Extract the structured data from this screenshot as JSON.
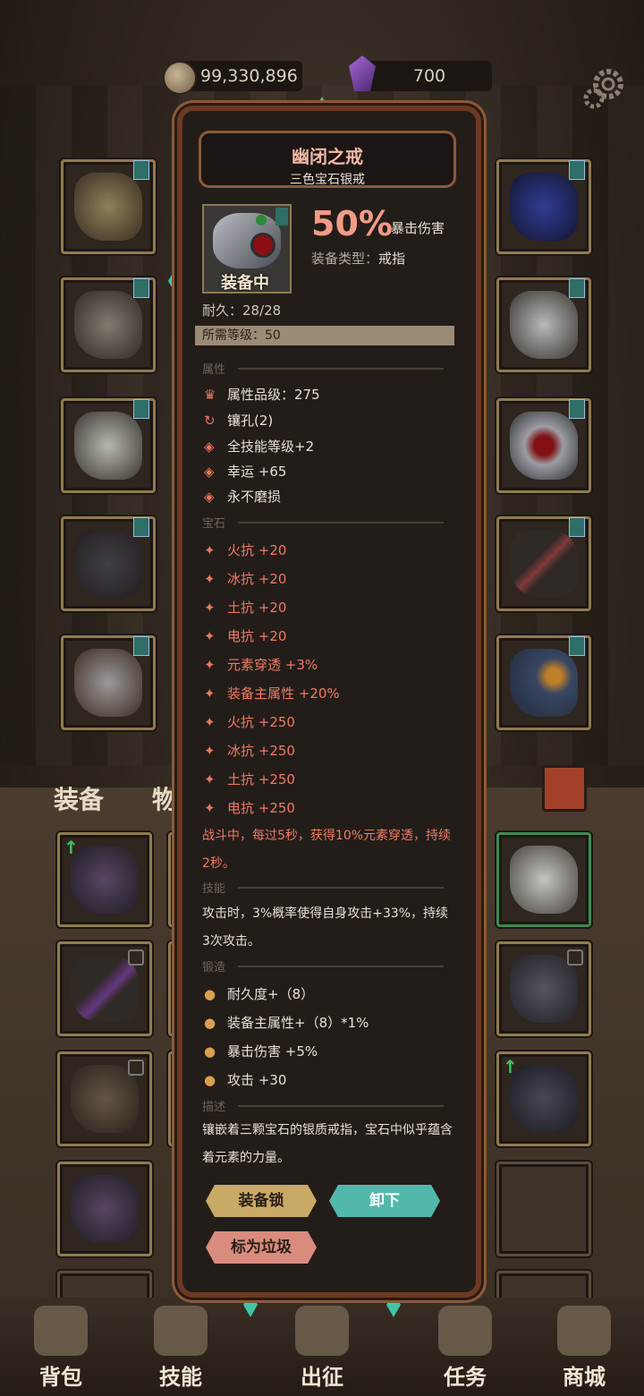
{
  "currency": {
    "coins": "99,330,896",
    "gems": "700"
  },
  "tabs": {
    "equipment": "装备",
    "items": "物品"
  },
  "item": {
    "name": "幽闭之戒",
    "subtitle": "三色宝石银戒",
    "equipped_label": "装备中",
    "main_value": "50%",
    "main_stat": "暴击伤害",
    "type_label": "装备类型：",
    "type_value": "戒指",
    "durability": "耐久：28/28",
    "required_level": "所需等级：50"
  },
  "sections": {
    "attributes": "属性",
    "gems": "宝石",
    "skills": "技能",
    "forge": "锻造",
    "description": "描述"
  },
  "attributes": [
    "属性品级：275",
    "镶孔(2)",
    "全技能等级+2",
    "幸运 +65",
    "永不磨损"
  ],
  "gem_stats": [
    "火抗 +20",
    "冰抗 +20",
    "土抗 +20",
    "电抗 +20",
    "元素穿透 +3%",
    "装备主属性 +20%",
    "火抗 +250",
    "冰抗 +250",
    "土抗 +250",
    "电抗 +250"
  ],
  "gem_effect": "战斗中，每过5秒，获得10%元素穿透，持续2秒。",
  "skill_text": "攻击时，3%概率使得自身攻击+33%，持续3次攻击。",
  "forge": [
    "耐久度+（8）",
    "装备主属性+（8）*1%",
    "暴击伤害 +5%",
    "攻击 +30"
  ],
  "description": "镶嵌着三颗宝石的银质戒指，宝石中似乎蕴含着元素的力量。",
  "buttons": {
    "lock": "装备锁",
    "unequip": "卸下",
    "trash": "标为垃圾"
  },
  "nav": [
    "背包",
    "技能",
    "出征",
    "任务",
    "商城"
  ],
  "colors": {
    "accent_red": "#f07a64",
    "accent_teal": "#52b8ac",
    "frame": "#8a5a3a"
  }
}
